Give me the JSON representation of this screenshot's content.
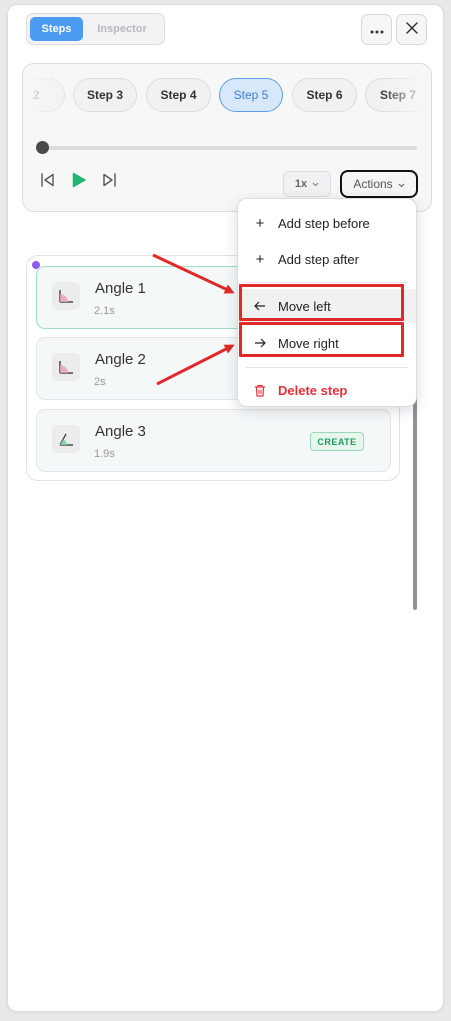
{
  "header": {
    "tabs": [
      {
        "label": "Steps"
      },
      {
        "label": "Inspector"
      }
    ],
    "more_icon": "more-horizontal-icon",
    "close_icon": "close-icon"
  },
  "player": {
    "steps": [
      {
        "label": "2"
      },
      {
        "label": "Step 3"
      },
      {
        "label": "Step 4"
      },
      {
        "label": "Step 5"
      },
      {
        "label": "Step 6"
      },
      {
        "label": "Step 7"
      }
    ],
    "active_step": "Step 5",
    "progress": 0,
    "speed_label": "1x",
    "actions_label": "Actions"
  },
  "steps_list": [
    {
      "title": "Angle 1",
      "duration": "2.1s"
    },
    {
      "title": "Angle 2",
      "duration": "2s"
    },
    {
      "title": "Angle 3",
      "duration": "1.9s",
      "badge": "CREATE"
    }
  ],
  "actions_menu": {
    "items": [
      {
        "label": "Add step before",
        "icon": "plus-icon"
      },
      {
        "label": "Add step after",
        "icon": "plus-icon"
      },
      {
        "label": "Move left",
        "icon": "arrow-left-icon"
      },
      {
        "label": "Move right",
        "icon": "arrow-right-icon"
      },
      {
        "label": "Delete step",
        "icon": "trash-icon"
      }
    ]
  },
  "colors": {
    "accent": "#4c9bf2",
    "play": "#22b573",
    "danger": "#e5303c",
    "annotation": "#e02a2a"
  }
}
